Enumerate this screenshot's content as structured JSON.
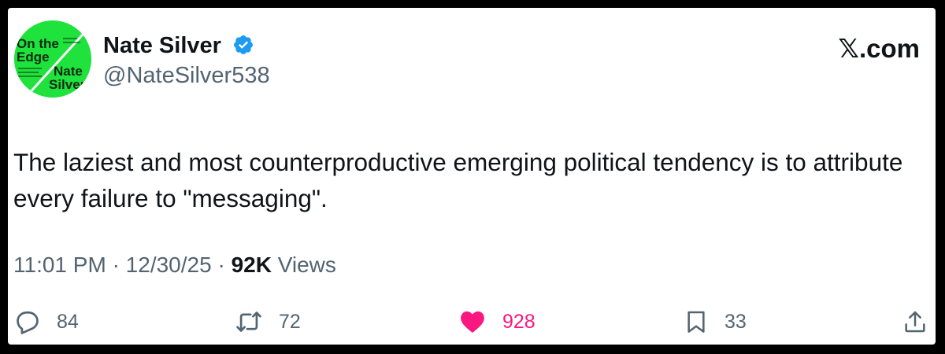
{
  "author": {
    "display_name": "Nate Silver",
    "handle": "@NateSilver538",
    "verified": true,
    "avatar": {
      "title_line1": "On the",
      "title_line2": "Edge",
      "name_line1": "Nate",
      "name_line2": "Silver",
      "background_color": "#1fe23c"
    }
  },
  "site_logo": "𝕏.com",
  "tweet": {
    "text": "The laziest and most counterproductive emerging political tendency is to attribute every failure to \"messaging\"."
  },
  "meta": {
    "time": "11:01 PM",
    "separator": "·",
    "date": "12/30/25",
    "views_count": "92K",
    "views_label": "Views"
  },
  "actions": {
    "reply": {
      "icon": "reply-icon",
      "count": "84"
    },
    "retweet": {
      "icon": "retweet-icon",
      "count": "72"
    },
    "like": {
      "icon": "heart-icon",
      "count": "928",
      "color": "#f91880"
    },
    "bookmark": {
      "icon": "bookmark-icon",
      "count": "33"
    },
    "share": {
      "icon": "share-icon"
    }
  },
  "colors": {
    "text_primary": "#0f1419",
    "text_secondary": "#536471",
    "verified_blue": "#1d9bf0",
    "like_pink": "#f91880"
  }
}
